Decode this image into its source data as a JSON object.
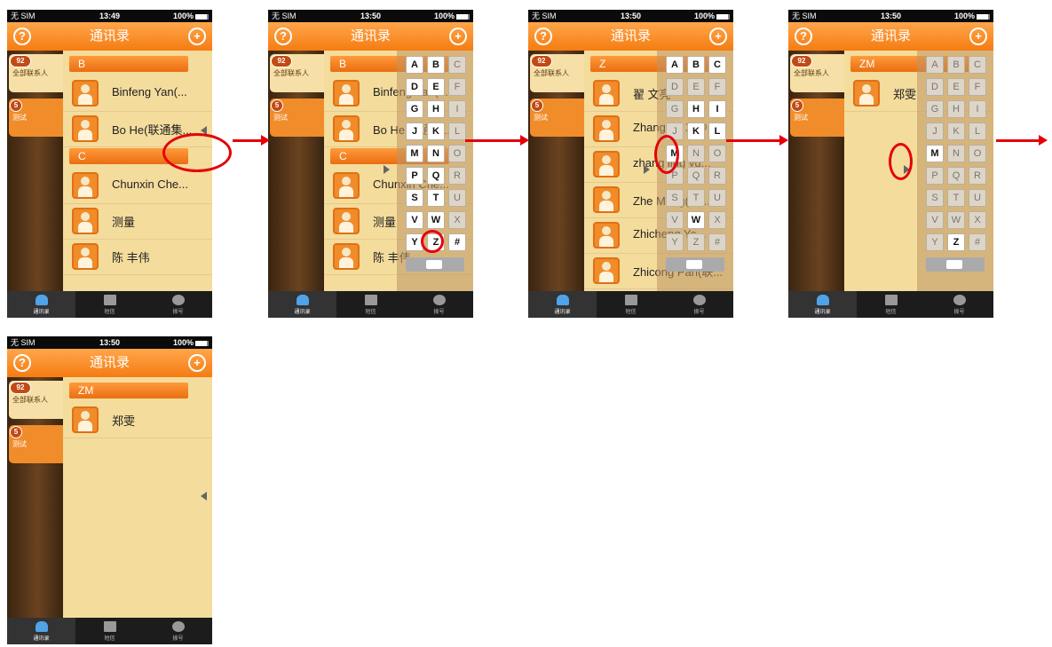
{
  "status": {
    "sim": "无 SIM",
    "times": [
      "13:49",
      "13:50",
      "13:50",
      "13:50",
      "13:50"
    ],
    "battery": "100%"
  },
  "title": "通讯录",
  "groups": {
    "all_label": "全部联系人",
    "all_count": "92",
    "test_label": "测试",
    "test_count": "5"
  },
  "tabs": [
    "通讯录",
    "短信",
    "拨号"
  ],
  "screens": [
    {
      "sections": [
        "B",
        "C"
      ],
      "contacts": [
        "Binfeng Yan(...",
        "Bo He(联通集...",
        "Chunxin Che...",
        "测量",
        "陈 丰伟"
      ]
    },
    {
      "sections": [
        "B",
        "C"
      ],
      "contacts": [
        "Binfeng Yan(...",
        "Bo He(联通集...",
        "Chunxin Che...",
        "测量",
        "陈 丰伟"
      ]
    },
    {
      "sections": [
        "Z"
      ],
      "contacts": [
        "翟 文亮",
        "Zhang Yu Xi@...",
        "zhang jing yu...",
        "Zhe Meng(联...",
        "Zhicheng Ya...",
        "Zhicong Pan(联..."
      ]
    },
    {
      "sections": [
        "ZM"
      ],
      "contacts": [
        "郑雯"
      ]
    },
    {
      "sections": [
        "ZM"
      ],
      "contacts": [
        "郑雯"
      ]
    }
  ],
  "keyboard": [
    "A",
    "B",
    "C",
    "D",
    "E",
    "F",
    "G",
    "H",
    "I",
    "J",
    "K",
    "L",
    "M",
    "N",
    "O",
    "P",
    "Q",
    "R",
    "S",
    "T",
    "U",
    "V",
    "W",
    "X",
    "Y",
    "Z",
    "#"
  ],
  "colors": {
    "accent": "#f57c12",
    "annotation": "#e5000a",
    "list_bg": "#f4dc9c"
  }
}
